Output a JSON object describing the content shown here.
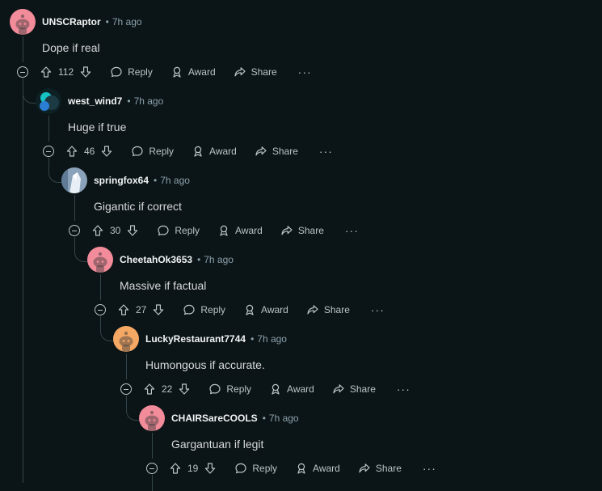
{
  "comments": [
    {
      "user": "UNSCRaptor",
      "time": "7h ago",
      "text": "Dope if real",
      "score": "112",
      "avatar_color": "#f28b9a"
    },
    {
      "user": "west_wind7",
      "time": "7h ago",
      "text": "Huge if true",
      "score": "46",
      "avatar_color": "#0d2b33"
    },
    {
      "user": "springfox64",
      "time": "7h ago",
      "text": "Gigantic if correct",
      "score": "30",
      "avatar_color": "#7f97b0"
    },
    {
      "user": "CheetahOk3653",
      "time": "7h ago",
      "text": "Massive if factual",
      "score": "27",
      "avatar_color": "#f28b9a"
    },
    {
      "user": "LuckyRestaurant7744",
      "time": "7h ago",
      "text": "Humongous if accurate.",
      "score": "22",
      "avatar_color": "#f5a764"
    },
    {
      "user": "CHAIRSareCOOLS",
      "time": "7h ago",
      "text": "Gargantuan if legit",
      "score": "19",
      "avatar_color": "#f28b9a"
    }
  ],
  "labels": {
    "reply": "Reply",
    "award": "Award",
    "share": "Share",
    "more": "···",
    "separator": "•"
  },
  "icons": {
    "upvote": "arrow-up-icon",
    "downvote": "arrow-down-icon",
    "reply": "speech-bubble-icon",
    "award": "award-ribbon-icon",
    "share": "share-arrow-icon",
    "collapse": "collapse-minus-icon"
  }
}
